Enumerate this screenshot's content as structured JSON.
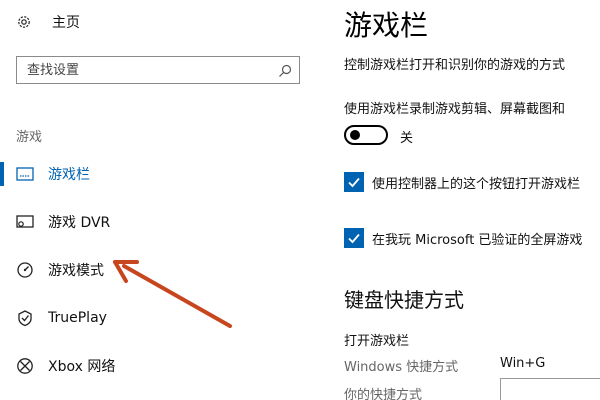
{
  "sidebar": {
    "home_label": "主页",
    "search": {
      "placeholder": "查找设置"
    },
    "section_label": "游戏",
    "items": [
      {
        "label": "游戏栏",
        "icon": "game-bar-icon",
        "active": true
      },
      {
        "label": "游戏 DVR",
        "icon": "game-dvr-icon",
        "active": false
      },
      {
        "label": "游戏模式",
        "icon": "game-mode-icon",
        "active": false
      },
      {
        "label": "TruePlay",
        "icon": "trueplay-icon",
        "active": false
      },
      {
        "label": "Xbox 网络",
        "icon": "xbox-icon",
        "active": false
      }
    ]
  },
  "main": {
    "title": "游戏栏",
    "description": "控制游戏栏打开和识别你的游戏的方式",
    "record_desc": "使用游戏栏录制游戏剪辑、屏幕截图和",
    "toggle": {
      "state": "关",
      "on": false
    },
    "checkboxes": [
      {
        "label": "使用控制器上的这个按钮打开游戏栏",
        "checked": true
      },
      {
        "label": "在我玩 Microsoft 已验证的全屏游戏",
        "checked": true
      }
    ],
    "shortcuts": {
      "title": "键盘快捷方式",
      "open_label": "打开游戏栏",
      "windows_label": "Windows 快捷方式",
      "windows_value": "Win+G",
      "your_label": "你的快捷方式",
      "your_value": ""
    }
  },
  "colors": {
    "accent": "#0063b1",
    "annotation_arrow": "#c8461e"
  }
}
